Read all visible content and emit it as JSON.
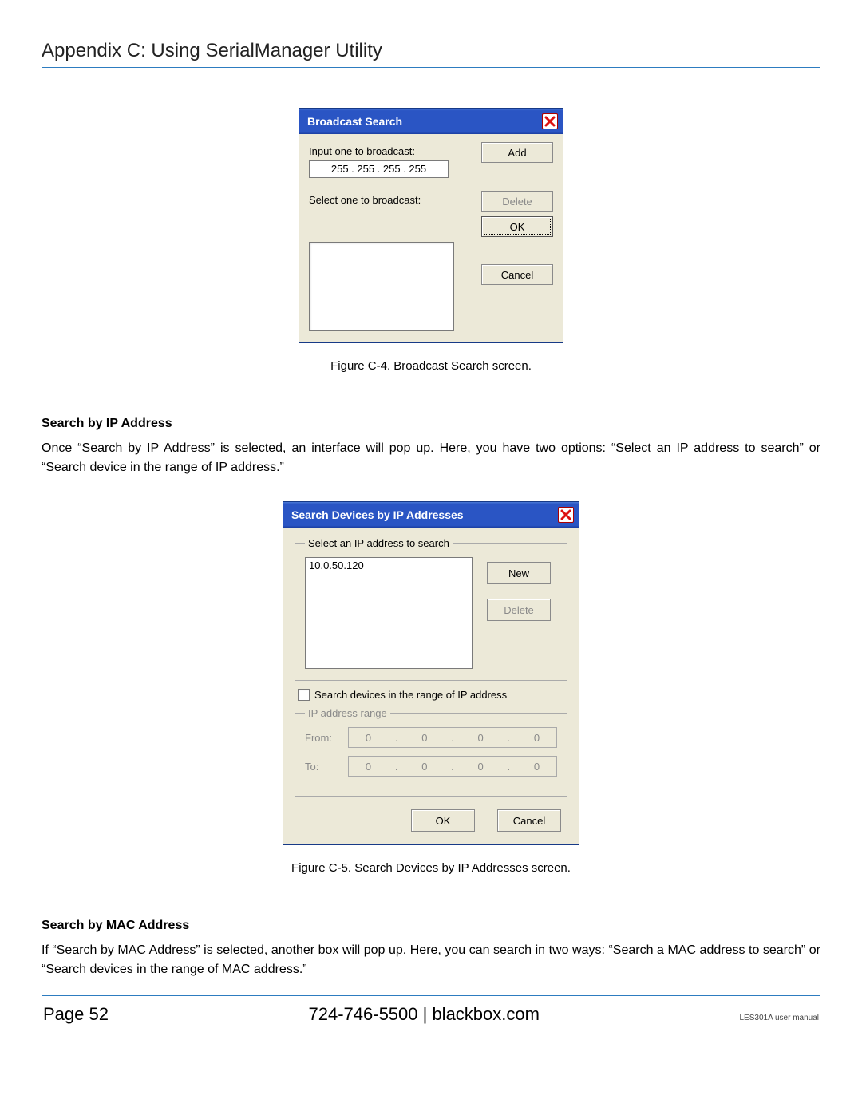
{
  "header": {
    "title": "Appendix C: Using SerialManager Utility"
  },
  "dialog1": {
    "title": "Broadcast Search",
    "input_label": "Input one to broadcast:",
    "ip_value": "255  .  255  .  255  .  255",
    "select_label": "Select one to broadcast:",
    "buttons": {
      "add": "Add",
      "delete": "Delete",
      "ok": "OK",
      "cancel": "Cancel"
    }
  },
  "caption1": "Figure C-4. Broadcast Search screen.",
  "section1": {
    "heading": "Search by IP Address",
    "body": "Once “Search by IP Address” is selected, an interface will pop up. Here, you have two options: “Select an IP address to search” or “Search device in the range of IP address.”"
  },
  "dialog2": {
    "title": "Search Devices by IP Addresses",
    "group1_legend": "Select an IP address to search",
    "list_item": "10.0.50.120",
    "buttons": {
      "new": "New",
      "delete": "Delete",
      "ok": "OK",
      "cancel": "Cancel"
    },
    "checkbox_label": "Search devices in the range of IP address",
    "group2_legend": "IP address range",
    "from_label": "From:",
    "to_label": "To:",
    "from_octets": [
      "0",
      "0",
      "0",
      "0"
    ],
    "to_octets": [
      "0",
      "0",
      "0",
      "0"
    ]
  },
  "caption2": "Figure C-5. Search Devices by IP Addresses screen.",
  "section2": {
    "heading": "Search by MAC Address",
    "body": "If “Search by MAC Address” is selected, another box will pop up. Here, you can search in two ways: “Search a MAC address to search” or “Search devices in the range of MAC address.”"
  },
  "footer": {
    "page": "Page 52",
    "center": "724-746-5500   |   blackbox.com",
    "right": "LES301A user manual"
  }
}
